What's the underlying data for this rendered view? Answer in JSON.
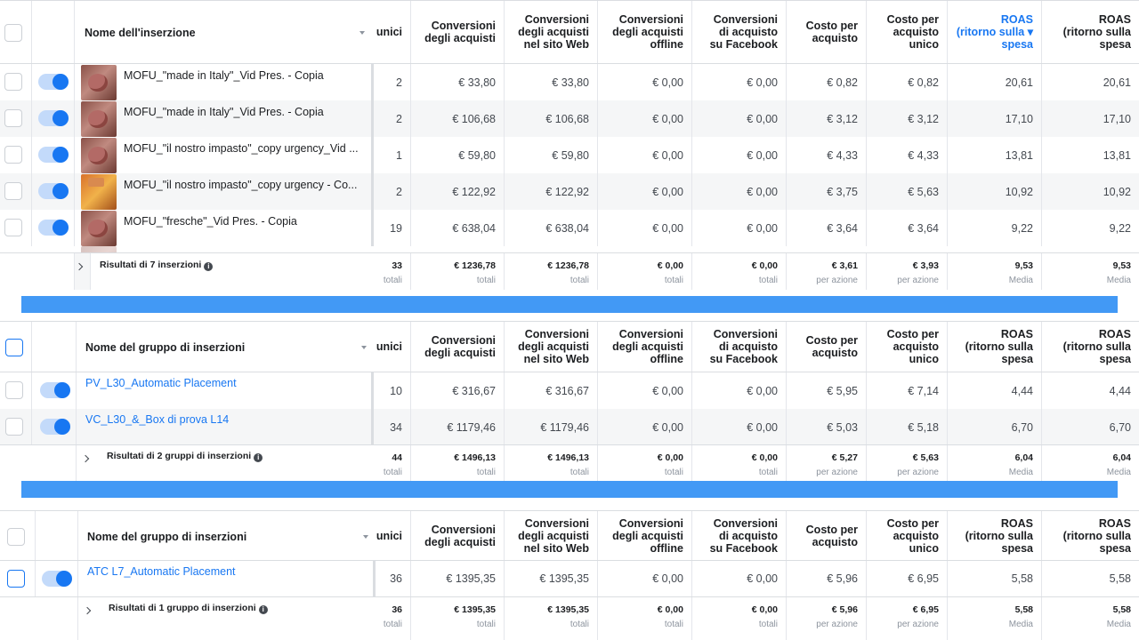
{
  "columns": {
    "unici": "unici",
    "conv_acquisti": "Conversioni\ndegli acquisti",
    "conv_web": "Conversioni\ndegli acquisti\nnel sito Web",
    "conv_offline": "Conversioni\ndegli acquisti\noffline",
    "conv_facebook": "Conversioni\ndi acquisto\nsu Facebook",
    "costo_acquisto": "Costo per\nacquisto",
    "costo_unico": "Costo per\nacquisto\nunico",
    "roas1": "ROAS\n(ritorno sulla\nspesa",
    "roas1_active": "ROAS\n(ritorno sulla ▾\nspesa",
    "roas2": "ROAS\n(ritorno sulla\nspesa"
  },
  "panel1": {
    "name_header": "Nome dell'inserzione",
    "rows": [
      {
        "name": "MOFU_\"made in Italy\"_Vid Pres. - Copia",
        "unici": "2",
        "conv": "€ 33,80",
        "web": "€ 33,80",
        "offline": "€ 0,00",
        "fb": "€ 0,00",
        "costo": "€ 0,82",
        "costo_u": "€ 0,82",
        "roas1": "20,61",
        "roas2": "20,61"
      },
      {
        "name": "MOFU_\"made in Italy\"_Vid Pres. - Copia",
        "unici": "2",
        "conv": "€ 106,68",
        "web": "€ 106,68",
        "offline": "€ 0,00",
        "fb": "€ 0,00",
        "costo": "€ 3,12",
        "costo_u": "€ 3,12",
        "roas1": "17,10",
        "roas2": "17,10"
      },
      {
        "name": "MOFU_\"il nostro impasto\"_copy urgency_Vid ...",
        "unici": "1",
        "conv": "€ 59,80",
        "web": "€ 59,80",
        "offline": "€ 0,00",
        "fb": "€ 0,00",
        "costo": "€ 4,33",
        "costo_u": "€ 4,33",
        "roas1": "13,81",
        "roas2": "13,81"
      },
      {
        "name": "MOFU_\"il nostro impasto\"_copy urgency - Co...",
        "unici": "2",
        "conv": "€ 122,92",
        "web": "€ 122,92",
        "offline": "€ 0,00",
        "fb": "€ 0,00",
        "costo": "€ 3,75",
        "costo_u": "€ 5,63",
        "roas1": "10,92",
        "roas2": "10,92"
      },
      {
        "name": "MOFU_\"fresche\"_Vid Pres. - Copia",
        "unici": "19",
        "conv": "€ 638,04",
        "web": "€ 638,04",
        "offline": "€ 0,00",
        "fb": "€ 0,00",
        "costo": "€ 3,64",
        "costo_u": "€ 3,64",
        "roas1": "9,22",
        "roas2": "9,22"
      }
    ],
    "summary": {
      "label": "Risultati di 7 inserzioni",
      "unici": "33",
      "conv": "€ 1236,78",
      "web": "€ 1236,78",
      "offline": "€ 0,00",
      "fb": "€ 0,00",
      "costo": "€ 3,61",
      "costo_u": "€ 3,93",
      "roas1": "9,53",
      "roas2": "9,53",
      "sub_totali": "totali",
      "sub_azione": "per azione",
      "sub_media": "Media"
    }
  },
  "panel2": {
    "name_header": "Nome del gruppo di inserzioni",
    "rows": [
      {
        "name": "PV_L30_Automatic Placement",
        "unici": "10",
        "conv": "€ 316,67",
        "web": "€ 316,67",
        "offline": "€ 0,00",
        "fb": "€ 0,00",
        "costo": "€ 5,95",
        "costo_u": "€ 7,14",
        "roas1": "4,44",
        "roas2": "4,44"
      },
      {
        "name": "VC_L30_&_Box di prova L14",
        "unici": "34",
        "conv": "€ 1179,46",
        "web": "€ 1179,46",
        "offline": "€ 0,00",
        "fb": "€ 0,00",
        "costo": "€ 5,03",
        "costo_u": "€ 5,18",
        "roas1": "6,70",
        "roas2": "6,70"
      }
    ],
    "summary": {
      "label": "Risultati di 2 gruppi di inserzioni",
      "unici": "44",
      "conv": "€ 1496,13",
      "web": "€ 1496,13",
      "offline": "€ 0,00",
      "fb": "€ 0,00",
      "costo": "€ 5,27",
      "costo_u": "€ 5,63",
      "roas1": "6,04",
      "roas2": "6,04",
      "sub_totali": "totali",
      "sub_azione": "per azione",
      "sub_media": "Media"
    }
  },
  "panel3": {
    "name_header": "Nome del gruppo di inserzioni",
    "rows": [
      {
        "name": "ATC L7_Automatic Placement",
        "unici": "36",
        "conv": "€ 1395,35",
        "web": "€ 1395,35",
        "offline": "€ 0,00",
        "fb": "€ 0,00",
        "costo": "€ 5,96",
        "costo_u": "€ 6,95",
        "roas1": "5,58",
        "roas2": "5,58"
      }
    ],
    "summary": {
      "label": "Risultati di 1 gruppo di inserzioni",
      "unici": "36",
      "conv": "€ 1395,35",
      "web": "€ 1395,35",
      "offline": "€ 0,00",
      "fb": "€ 0,00",
      "costo": "€ 5,96",
      "costo_u": "€ 6,95",
      "roas1": "5,58",
      "roas2": "5,58",
      "sub_totali": "totali",
      "sub_azione": "per azione",
      "sub_media": "Media"
    }
  },
  "icons": {
    "info": "i",
    "sort_caret": "caret-down-icon",
    "expand": "chevron-right-icon"
  },
  "colors": {
    "accent": "#1877f2",
    "band": "#4299f5",
    "alt_row": "#f5f6f7"
  }
}
